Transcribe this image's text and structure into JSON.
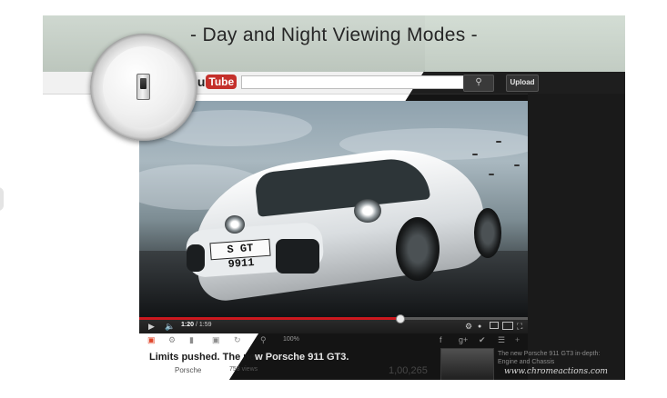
{
  "banner": {
    "title": "- Day and Night Viewing Modes -"
  },
  "header": {
    "logo_prefix": "You",
    "logo_suffix": "Tube",
    "search_placeholder": "",
    "upload_label": "Upload"
  },
  "video": {
    "plate_text": "S GT 9911",
    "progress_fraction": 0.67,
    "time_current": "1:20",
    "time_total": "1:59",
    "zoom_level": "100%"
  },
  "info": {
    "title_dark_part": "Limits pushed. The ne",
    "title_light_part": "w Porsche 911 GT3.",
    "channel": "Porsche",
    "views": "758 views",
    "count": "1,00,265"
  },
  "related": {
    "title": "The new Porsche 911 GT3 in-depth: Engine and Chassis"
  },
  "watermark": "www.chromeactions.com",
  "colors": {
    "accent_red": "#cc181e",
    "youtube_red": "#c4302b"
  },
  "icons": [
    "magnifier-icon",
    "toggle-switch-icon",
    "search-icon",
    "play-icon",
    "volume-icon",
    "settings-icon",
    "fullscreen-icon",
    "facebook-icon",
    "google-plus-icon",
    "twitter-icon"
  ]
}
